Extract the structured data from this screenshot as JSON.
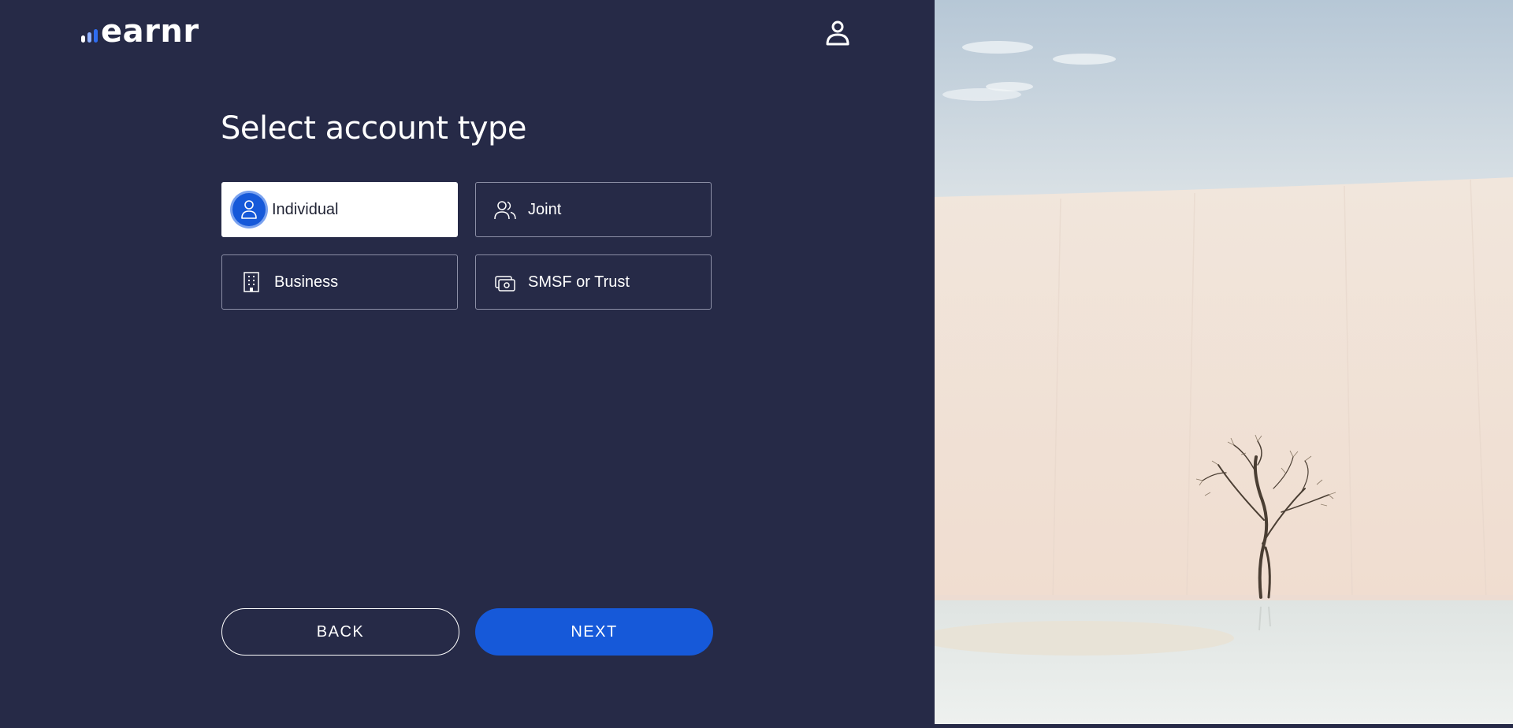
{
  "brand": {
    "name": "earnr",
    "bar_colors": [
      "#ffffff",
      "#8fb0ff",
      "#2f6df0"
    ]
  },
  "header": {
    "user_icon": "user-icon"
  },
  "page": {
    "title": "Select account type"
  },
  "options": [
    {
      "label": "Individual",
      "icon": "person-icon",
      "selected": true
    },
    {
      "label": "Joint",
      "icon": "people-icon",
      "selected": false
    },
    {
      "label": "Business",
      "icon": "building-icon",
      "selected": false
    },
    {
      "label": "SMSF or Trust",
      "icon": "safe-icon",
      "selected": false
    }
  ],
  "actions": {
    "back_label": "BACK",
    "next_label": "NEXT"
  },
  "colors": {
    "background": "#262a47",
    "accent": "#1659d9",
    "text": "#ffffff"
  }
}
